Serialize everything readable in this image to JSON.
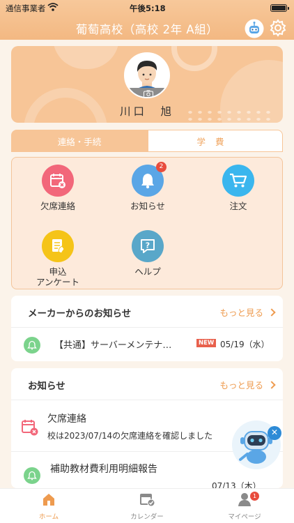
{
  "status_bar": {
    "carrier": "通信事業者",
    "time": "午後5:18"
  },
  "header": {
    "title": "葡萄高校（高校 2年 A組）"
  },
  "profile": {
    "name": "川口　旭"
  },
  "tabs": [
    {
      "label": "連絡・手続"
    },
    {
      "label": "学費"
    }
  ],
  "menu": {
    "items": [
      {
        "label": "欠席連絡",
        "icon": "calendar-absence-icon",
        "color": "#f2677a"
      },
      {
        "label": "お知らせ",
        "icon": "bell-icon",
        "color": "#5aa6e6",
        "badge": "2"
      },
      {
        "label": "注文",
        "icon": "cart-icon",
        "color": "#3ab6ee"
      },
      {
        "label": "申込\nアンケート",
        "icon": "form-icon",
        "color": "#f5c418"
      },
      {
        "label": "ヘルプ",
        "icon": "help-icon",
        "color": "#59a7c9"
      }
    ]
  },
  "maker_news": {
    "title": "メーカーからのお知らせ",
    "more": "もっと見る",
    "items": [
      {
        "text": "【共通】サーバーメンテナ…",
        "badge": "NEW",
        "date": "05/19（水）"
      }
    ]
  },
  "news": {
    "title": "お知らせ",
    "more": "もっと見る",
    "items": [
      {
        "title": "欠席連絡",
        "body": "校は2023/07/14の欠席連絡を確認しました"
      },
      {
        "title": "補助教材費利用明細報告",
        "date": "07/13（木）"
      }
    ]
  },
  "bottom_nav": {
    "items": [
      {
        "label": "ホーム",
        "active": true
      },
      {
        "label": "カレンダー"
      },
      {
        "label": "マイページ",
        "badge": "1"
      }
    ]
  },
  "colors": {
    "accent": "#f3b882",
    "link": "#ee9b4f",
    "badge": "#e84c3d"
  }
}
